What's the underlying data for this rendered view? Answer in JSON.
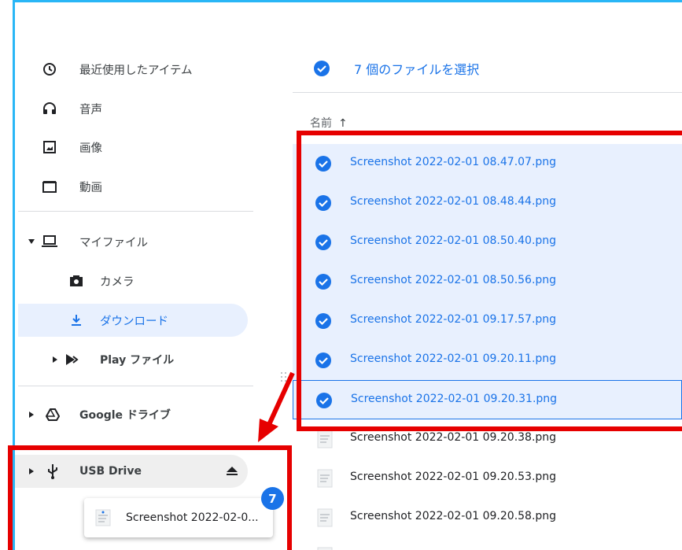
{
  "sidebar": {
    "items": [
      {
        "label": "最近使用したアイテム",
        "icon": "clock-icon"
      },
      {
        "label": "音声",
        "icon": "headphones-icon"
      },
      {
        "label": "画像",
        "icon": "image-icon"
      },
      {
        "label": "動画",
        "icon": "video-icon"
      },
      {
        "label": "マイファイル",
        "icon": "laptop-icon"
      },
      {
        "label": "カメラ",
        "icon": "camera-icon"
      },
      {
        "label": "ダウンロード",
        "icon": "download-icon"
      },
      {
        "label": "Play ファイル",
        "icon": "play-icon"
      },
      {
        "label": "Google ドライブ",
        "icon": "drive-icon"
      },
      {
        "label": "USB Drive",
        "icon": "usb-icon"
      }
    ]
  },
  "drag": {
    "file_label": "Screenshot 2022-02-0...",
    "count": "7"
  },
  "main": {
    "selection_text": "7 個のファイルを選択",
    "column_name": "名前",
    "sort_arrow": "↑",
    "files": [
      {
        "name": "Screenshot 2022-02-01 08.47.07.png",
        "selected": true
      },
      {
        "name": "Screenshot 2022-02-01 08.48.44.png",
        "selected": true
      },
      {
        "name": "Screenshot 2022-02-01 08.50.40.png",
        "selected": true
      },
      {
        "name": "Screenshot 2022-02-01 08.50.56.png",
        "selected": true
      },
      {
        "name": "Screenshot 2022-02-01 09.17.57.png",
        "selected": true
      },
      {
        "name": "Screenshot 2022-02-01 09.20.11.png",
        "selected": true
      },
      {
        "name": "Screenshot 2022-02-01 09.20.31.png",
        "selected": true
      },
      {
        "name": "Screenshot 2022-02-01 09.20.38.png",
        "selected": false
      },
      {
        "name": "Screenshot 2022-02-01 09.20.53.png",
        "selected": false
      },
      {
        "name": "Screenshot 2022-02-01 09.20.58.png",
        "selected": false
      }
    ]
  },
  "colors": {
    "accent": "#1a73e8",
    "selected_bg": "#e8f0fe",
    "annotation_red": "#e60000",
    "frame": "#29b6f6"
  }
}
